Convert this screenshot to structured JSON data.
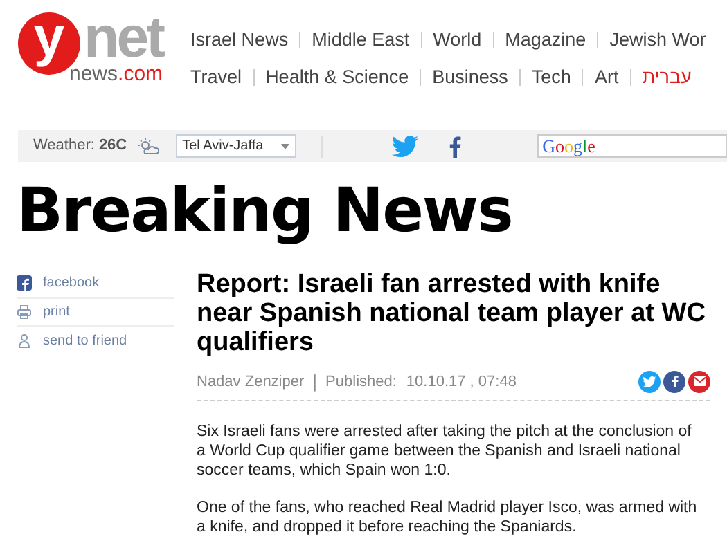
{
  "logo": {
    "letter": "y",
    "word": "net",
    "domain": "news",
    "tld": ".com"
  },
  "nav_rows": [
    [
      {
        "label": "Israel News",
        "kind": "link"
      },
      {
        "label": "Middle East",
        "kind": "link"
      },
      {
        "label": "World",
        "kind": "link"
      },
      {
        "label": "Magazine",
        "kind": "link"
      },
      {
        "label": "Jewish Wor",
        "kind": "link"
      }
    ],
    [
      {
        "label": "Travel",
        "kind": "link"
      },
      {
        "label": "Health & Science",
        "kind": "link"
      },
      {
        "label": "Business",
        "kind": "link"
      },
      {
        "label": "Tech",
        "kind": "link"
      },
      {
        "label": "Art",
        "kind": "link"
      },
      {
        "label": "עברית",
        "kind": "language"
      }
    ]
  ],
  "toolbar": {
    "weather_label": "Weather:",
    "temperature": "26C",
    "city": "Tel Aviv-Jaffa",
    "search_logo": "Google"
  },
  "section_title": "Breaking News",
  "share_sidebar": [
    {
      "label": "facebook",
      "kind": "facebook"
    },
    {
      "label": "print",
      "kind": "print"
    },
    {
      "label": "send to friend",
      "kind": "friend"
    }
  ],
  "article": {
    "headline": "Report: Israeli fan arrested with knife near Spanish national team player at WC qualifiers",
    "author": "Nadav Zenziper",
    "separator": "|",
    "published_label": "Published:",
    "date": "10.10.17 , 07:48",
    "paragraphs": [
      "Six Israeli fans were arrested after taking the pitch at the conclusion of a World Cup qualifier game between the Spanish and Israeli national soccer teams, which Spain won 1:0.",
      "One of the fans, who reached Real Madrid player Isco, was armed with a knife, and dropped it before reaching the Spaniards."
    ]
  }
}
